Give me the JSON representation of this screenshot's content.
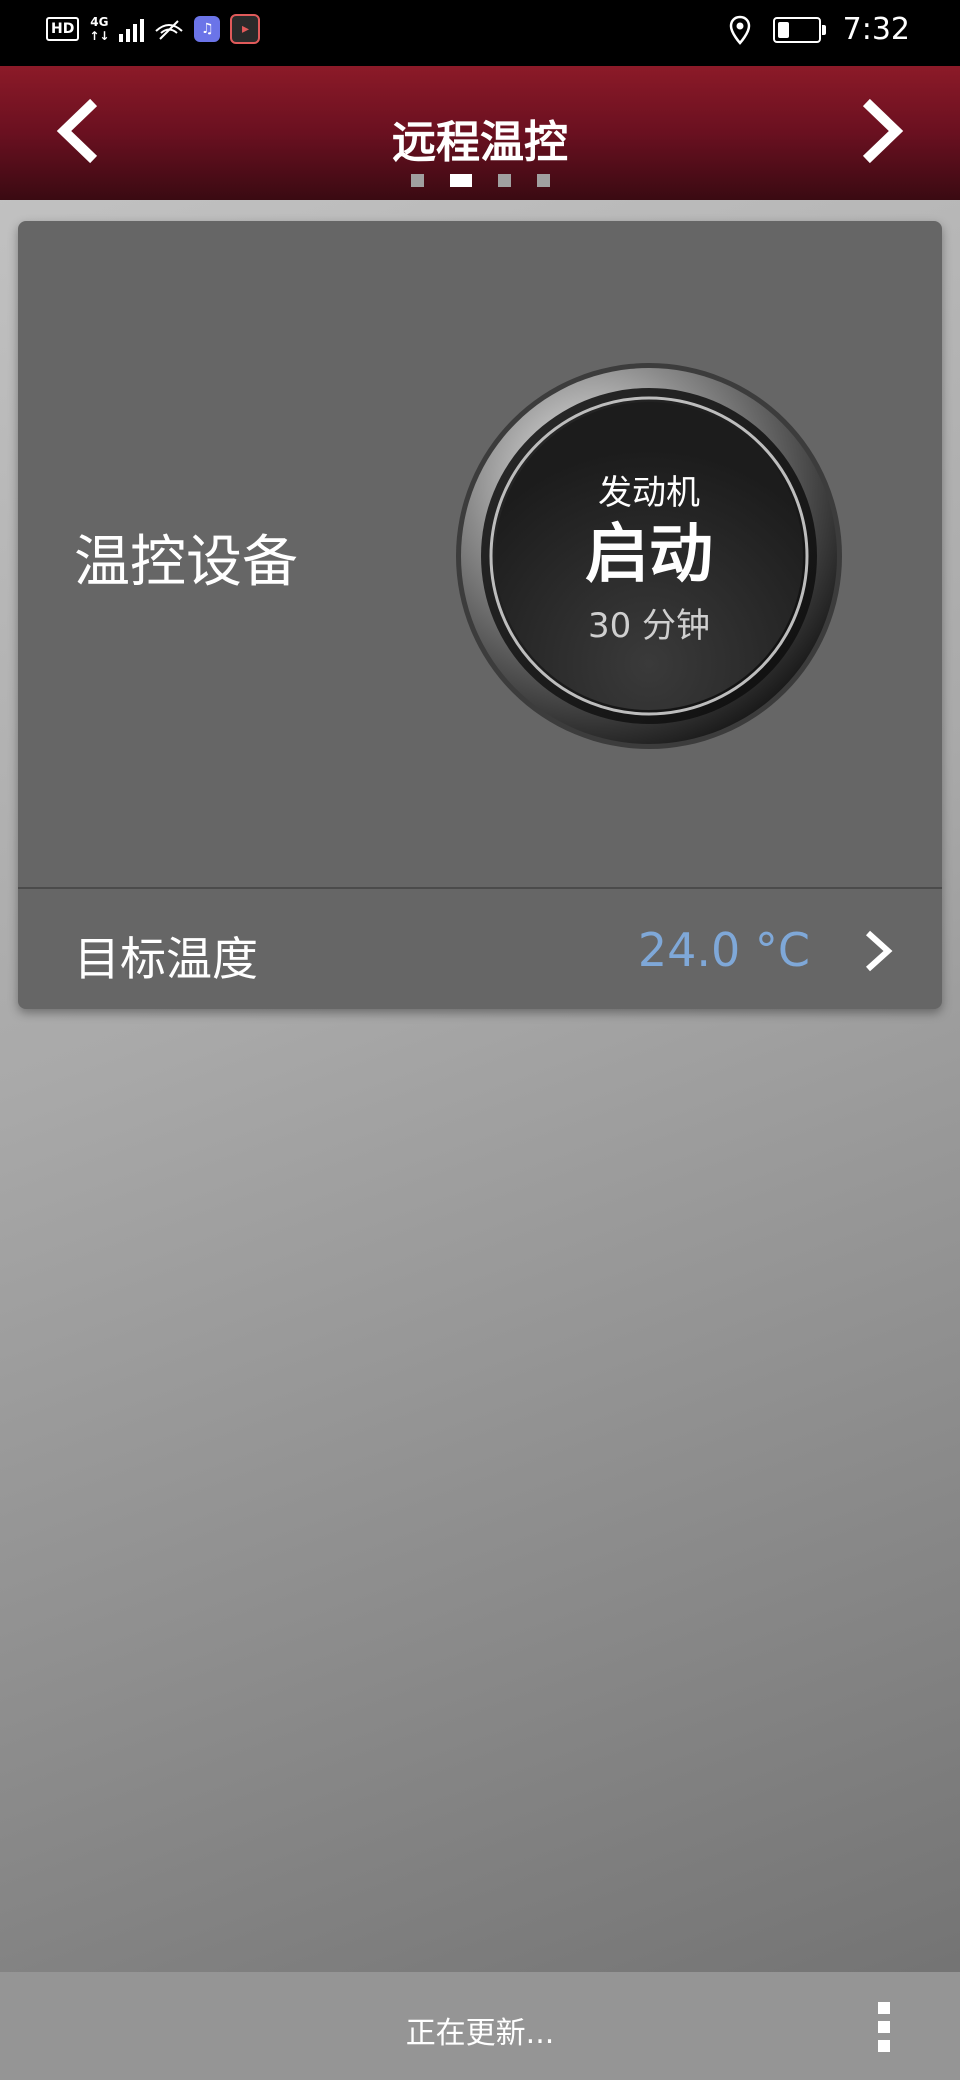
{
  "status_bar": {
    "hd": "HD",
    "network_top": "4G",
    "network_bottom": "↑↓",
    "time": "7:32",
    "battery_level": 0.3
  },
  "header": {
    "title": "远程温控",
    "page_count": 4,
    "active_page": 2
  },
  "device": {
    "label": "温控设备",
    "dial_subtitle": "发动机",
    "dial_action": "启动",
    "dial_duration": "30 分钟"
  },
  "target_temp": {
    "label": "目标温度",
    "value": "24.0 °C"
  },
  "footer": {
    "status": "正在更新..."
  },
  "colors": {
    "accent_red": "#6a1020",
    "temp_value": "#7fa8d8"
  }
}
